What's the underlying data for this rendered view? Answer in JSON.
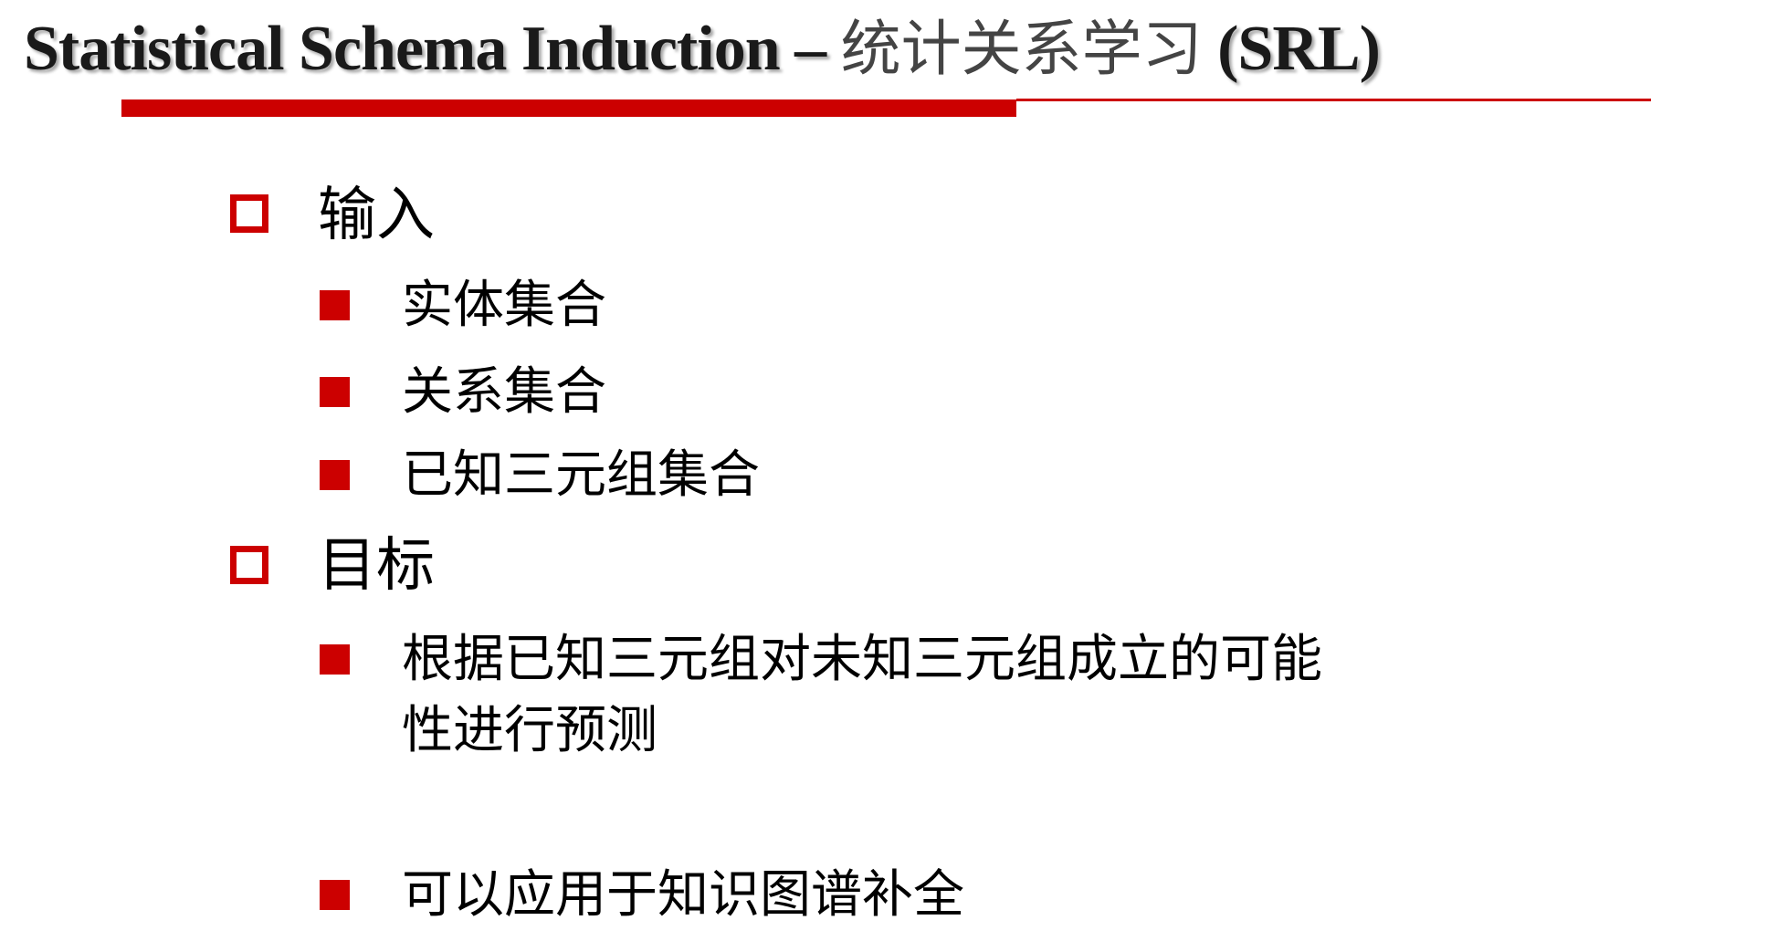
{
  "title": {
    "english": "Statistical Schema Induction – ",
    "chinese": "统计关系学习",
    "acronym": " (SRL)"
  },
  "accent_color": "#cc0000",
  "bullets": {
    "input": {
      "label": "输入",
      "items": [
        "实体集合",
        "关系集合",
        "已知三元组集合"
      ]
    },
    "goal": {
      "label": "目标",
      "items": [
        {
          "line1": "根据已知三元组对未知三元组成立的可能",
          "line2": "性进行预测"
        },
        {
          "line1": "可以应用于知识图谱补全"
        }
      ]
    }
  }
}
